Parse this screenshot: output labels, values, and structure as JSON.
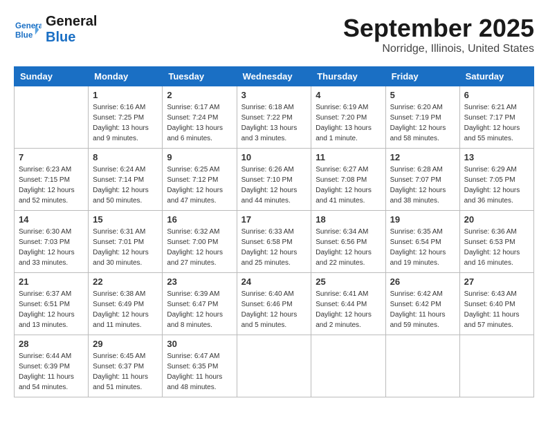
{
  "logo": {
    "line1": "General",
    "line2": "Blue"
  },
  "title": "September 2025",
  "location": "Norridge, Illinois, United States",
  "weekdays": [
    "Sunday",
    "Monday",
    "Tuesday",
    "Wednesday",
    "Thursday",
    "Friday",
    "Saturday"
  ],
  "weeks": [
    [
      {
        "day": "",
        "info": ""
      },
      {
        "day": "1",
        "info": "Sunrise: 6:16 AM\nSunset: 7:25 PM\nDaylight: 13 hours\nand 9 minutes."
      },
      {
        "day": "2",
        "info": "Sunrise: 6:17 AM\nSunset: 7:24 PM\nDaylight: 13 hours\nand 6 minutes."
      },
      {
        "day": "3",
        "info": "Sunrise: 6:18 AM\nSunset: 7:22 PM\nDaylight: 13 hours\nand 3 minutes."
      },
      {
        "day": "4",
        "info": "Sunrise: 6:19 AM\nSunset: 7:20 PM\nDaylight: 13 hours\nand 1 minute."
      },
      {
        "day": "5",
        "info": "Sunrise: 6:20 AM\nSunset: 7:19 PM\nDaylight: 12 hours\nand 58 minutes."
      },
      {
        "day": "6",
        "info": "Sunrise: 6:21 AM\nSunset: 7:17 PM\nDaylight: 12 hours\nand 55 minutes."
      }
    ],
    [
      {
        "day": "7",
        "info": "Sunrise: 6:23 AM\nSunset: 7:15 PM\nDaylight: 12 hours\nand 52 minutes."
      },
      {
        "day": "8",
        "info": "Sunrise: 6:24 AM\nSunset: 7:14 PM\nDaylight: 12 hours\nand 50 minutes."
      },
      {
        "day": "9",
        "info": "Sunrise: 6:25 AM\nSunset: 7:12 PM\nDaylight: 12 hours\nand 47 minutes."
      },
      {
        "day": "10",
        "info": "Sunrise: 6:26 AM\nSunset: 7:10 PM\nDaylight: 12 hours\nand 44 minutes."
      },
      {
        "day": "11",
        "info": "Sunrise: 6:27 AM\nSunset: 7:08 PM\nDaylight: 12 hours\nand 41 minutes."
      },
      {
        "day": "12",
        "info": "Sunrise: 6:28 AM\nSunset: 7:07 PM\nDaylight: 12 hours\nand 38 minutes."
      },
      {
        "day": "13",
        "info": "Sunrise: 6:29 AM\nSunset: 7:05 PM\nDaylight: 12 hours\nand 36 minutes."
      }
    ],
    [
      {
        "day": "14",
        "info": "Sunrise: 6:30 AM\nSunset: 7:03 PM\nDaylight: 12 hours\nand 33 minutes."
      },
      {
        "day": "15",
        "info": "Sunrise: 6:31 AM\nSunset: 7:01 PM\nDaylight: 12 hours\nand 30 minutes."
      },
      {
        "day": "16",
        "info": "Sunrise: 6:32 AM\nSunset: 7:00 PM\nDaylight: 12 hours\nand 27 minutes."
      },
      {
        "day": "17",
        "info": "Sunrise: 6:33 AM\nSunset: 6:58 PM\nDaylight: 12 hours\nand 25 minutes."
      },
      {
        "day": "18",
        "info": "Sunrise: 6:34 AM\nSunset: 6:56 PM\nDaylight: 12 hours\nand 22 minutes."
      },
      {
        "day": "19",
        "info": "Sunrise: 6:35 AM\nSunset: 6:54 PM\nDaylight: 12 hours\nand 19 minutes."
      },
      {
        "day": "20",
        "info": "Sunrise: 6:36 AM\nSunset: 6:53 PM\nDaylight: 12 hours\nand 16 minutes."
      }
    ],
    [
      {
        "day": "21",
        "info": "Sunrise: 6:37 AM\nSunset: 6:51 PM\nDaylight: 12 hours\nand 13 minutes."
      },
      {
        "day": "22",
        "info": "Sunrise: 6:38 AM\nSunset: 6:49 PM\nDaylight: 12 hours\nand 11 minutes."
      },
      {
        "day": "23",
        "info": "Sunrise: 6:39 AM\nSunset: 6:47 PM\nDaylight: 12 hours\nand 8 minutes."
      },
      {
        "day": "24",
        "info": "Sunrise: 6:40 AM\nSunset: 6:46 PM\nDaylight: 12 hours\nand 5 minutes."
      },
      {
        "day": "25",
        "info": "Sunrise: 6:41 AM\nSunset: 6:44 PM\nDaylight: 12 hours\nand 2 minutes."
      },
      {
        "day": "26",
        "info": "Sunrise: 6:42 AM\nSunset: 6:42 PM\nDaylight: 11 hours\nand 59 minutes."
      },
      {
        "day": "27",
        "info": "Sunrise: 6:43 AM\nSunset: 6:40 PM\nDaylight: 11 hours\nand 57 minutes."
      }
    ],
    [
      {
        "day": "28",
        "info": "Sunrise: 6:44 AM\nSunset: 6:39 PM\nDaylight: 11 hours\nand 54 minutes."
      },
      {
        "day": "29",
        "info": "Sunrise: 6:45 AM\nSunset: 6:37 PM\nDaylight: 11 hours\nand 51 minutes."
      },
      {
        "day": "30",
        "info": "Sunrise: 6:47 AM\nSunset: 6:35 PM\nDaylight: 11 hours\nand 48 minutes."
      },
      {
        "day": "",
        "info": ""
      },
      {
        "day": "",
        "info": ""
      },
      {
        "day": "",
        "info": ""
      },
      {
        "day": "",
        "info": ""
      }
    ]
  ]
}
